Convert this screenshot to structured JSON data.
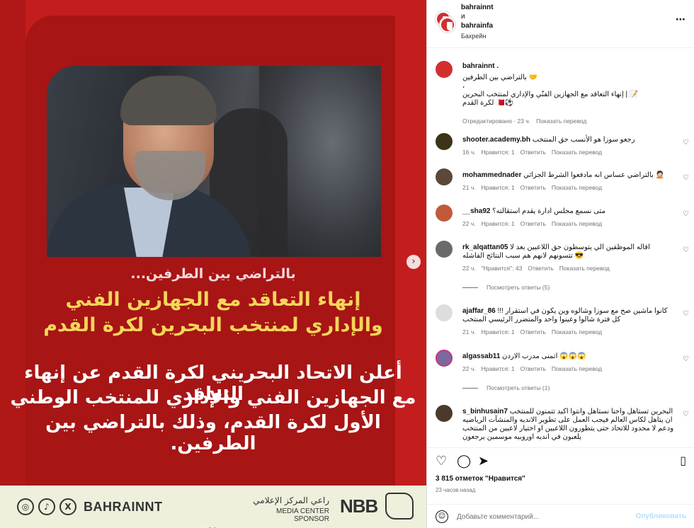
{
  "post": {
    "sub": "بالتراضي بين الطرفين...",
    "headline1": "إنهاء التعاقد مع الجهازين الفني",
    "headline2": "والإداري لمنتخب البحرين لكرة القدم",
    "body1": "أعلن الاتحاد البحريني لكرة القدم عن إنهاء التعاقد",
    "body2": "مع الجهازين الفني والإداري للمنتخب الوطني",
    "body3": "الأول لكرة القدم، وذلك بالتراضي بين الطرفين.",
    "footer_handle": "BAHRAINNT",
    "sponsor_ar": "راعي المركز الإعلامي",
    "sponsor_en": "MEDIA CENTER SPONSOR",
    "sponsor_brand": "NBB",
    "sponsor_mark": "بنك البحرين الوطني"
  },
  "header": {
    "user1": "bahrainnt",
    "conj": "и",
    "user2": "bahrainfa",
    "location": "Бахрейн"
  },
  "caption": {
    "user": "bahrainnt .",
    "line1": "بالتراضي بين الطرفين 🤝",
    "line2": "،",
    "line3": "📝 | إنهاء التعاقد مع الجهازين الفنّي والإداري لمنتخب البحرين",
    "line4": "لكرة القدم 🇧🇭⚽",
    "edited": "Отредактировано · 23 ч.",
    "translate": "Показать перевод"
  },
  "comments": [
    {
      "user": "shooter.academy.bh",
      "text": "رجعو سوزا هو الأنسب حق المنتخب",
      "time": "16 ч.",
      "likes": "Нравится: 1",
      "reply": "Ответить",
      "translate": "Показать перевод"
    },
    {
      "user": "mohammednader",
      "text": "بالتراضي عساس انه مادفعوا الشرط الجزائي 🤦🏻",
      "time": "21 ч.",
      "likes": "Нравится: 1",
      "reply": "Ответить",
      "translate": "Показать перевод"
    },
    {
      "user": "__sha92",
      "text": "متى نسمع مجلس ادارة يقدم استقالته؟",
      "time": "22 ч.",
      "likes": "Нравится: 1",
      "reply": "Ответить",
      "translate": "Показать перевод"
    },
    {
      "user": "rk_alqattan05",
      "text": "اقاله الموظفين الي يتوسطون حق اللاعبين بعد لا تتسونهم لانهم هم سبب النتائج الفاشله 😎",
      "time": "22 ч.",
      "likes": "\"Нравится\": 43",
      "reply": "Ответить",
      "translate": "Показать перевод",
      "replies": "Посмотреть ответы (5)"
    },
    {
      "user": "ajaffar_86",
      "text": "كانوا ماشين صح مع سوزا وشالوه وين يكون في استقرار !!! كل فترة شالوا وعينوا واحد والمتضرر الرئيسي المنتخب",
      "time": "21 ч.",
      "likes": "Нравится: 1",
      "reply": "Ответить",
      "translate": "Показать перевод"
    },
    {
      "user": "algassab11",
      "text": "اتمنى مدرب الاردن 😱😱😱",
      "time": "22 ч.",
      "likes": "Нравится: 1",
      "reply": "Ответить",
      "translate": "Показать перевод",
      "replies": "Посмотреть ответы (1)"
    },
    {
      "user": "s_binhusain7",
      "text": "البحرين تستاهل واحنا نستاهل وانتوا اكيد تتمنون للمنتخب ان يتاهل لكاس العالم فيجب العمل على تطوير الانديه والمنشآت الرياضيه ودعم لا محدود للاتحاد حتى يتطورون اللاعبين او اختيار لاعبين من المنتخب يلعبون في انديه اوروبيه موسمين يرجعون",
      "time": "",
      "likes": "",
      "reply": "",
      "translate": ""
    }
  ],
  "stats": {
    "likes": "3 815 отметок \"Нравится\"",
    "time": "23 часов назад"
  },
  "compose": {
    "placeholder": "Добавьте комментарий...",
    "publish": "Опубликовать"
  }
}
